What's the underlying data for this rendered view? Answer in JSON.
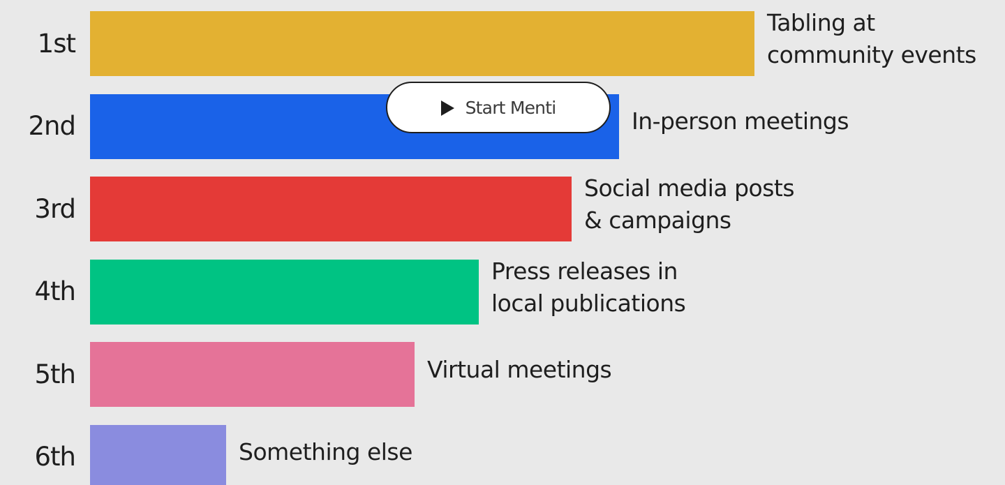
{
  "chart_data": {
    "type": "bar",
    "orientation": "horizontal",
    "categories": [
      "1st",
      "2nd",
      "3rd",
      "4th",
      "5th",
      "6th"
    ],
    "labels": [
      "Tabling at\ncommunity events",
      "In-person meetings",
      "Social media posts\n& campaigns",
      "Press releases in\nlocal publications",
      "Virtual meetings",
      "Something else"
    ],
    "values": [
      100,
      79.6,
      72.5,
      58.5,
      48.8,
      20.5
    ],
    "xlim": [
      0,
      100
    ],
    "colors": [
      "#e3b132",
      "#1a62e8",
      "#e43a37",
      "#00c383",
      "#e57398",
      "#8a8cdf"
    ],
    "grid": false,
    "legend": "none"
  },
  "controls": {
    "start_button_label": "Start Menti",
    "start_button_icon": "play-icon"
  }
}
